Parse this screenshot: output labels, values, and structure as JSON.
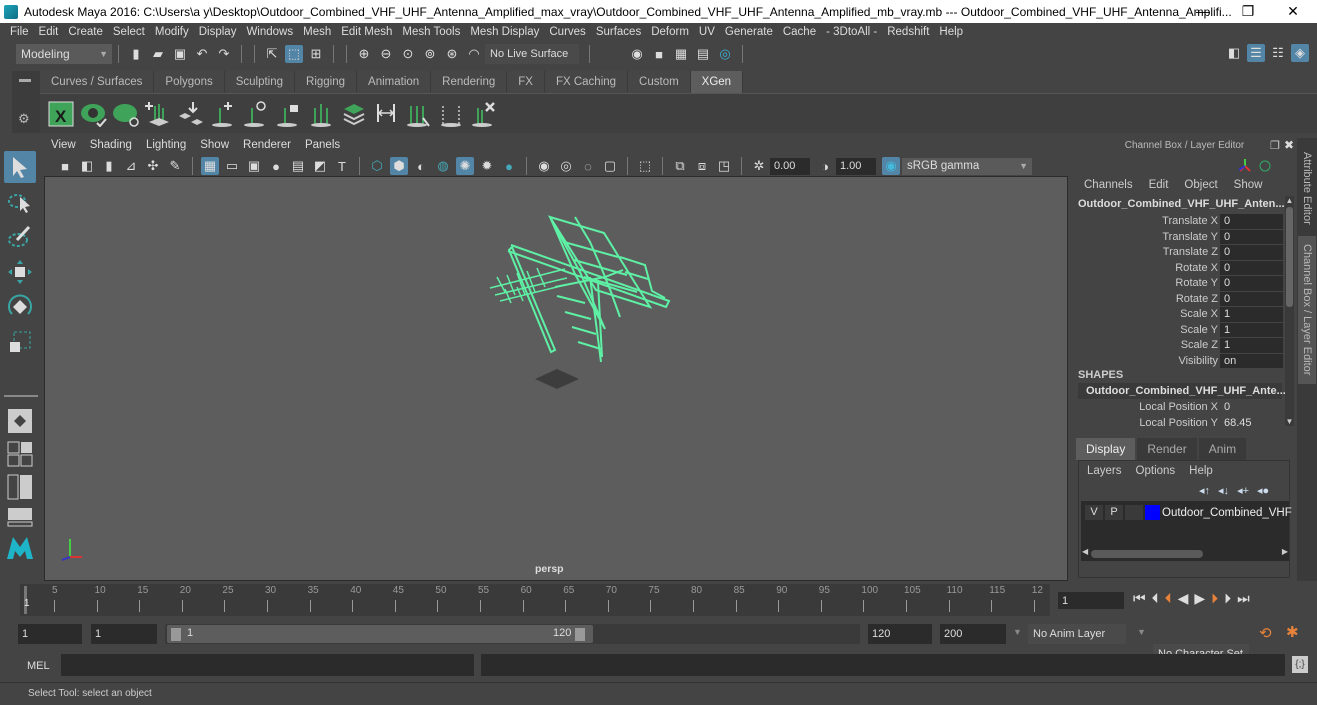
{
  "window": {
    "title": "Autodesk Maya 2016: C:\\Users\\a y\\Desktop\\Outdoor_Combined_VHF_UHF_Antenna_Amplified_max_vray\\Outdoor_Combined_VHF_UHF_Antenna_Amplified_mb_vray.mb  ---  Outdoor_Combined_VHF_UHF_Antenna_Amplifi...",
    "minimize": "—",
    "restore": "❐",
    "close": "✕"
  },
  "menubar": [
    "File",
    "Edit",
    "Create",
    "Select",
    "Modify",
    "Display",
    "Windows",
    "Mesh",
    "Edit Mesh",
    "Mesh Tools",
    "Mesh Display",
    "Curves",
    "Surfaces",
    "Deform",
    "UV",
    "Generate",
    "Cache",
    "- 3DtoAll -",
    "Redshift",
    "Help"
  ],
  "statusline": {
    "menuset": "Modeling",
    "live_surface": "No Live Surface"
  },
  "shelf": {
    "tabs": [
      "Curves / Surfaces",
      "Polygons",
      "Sculpting",
      "Rigging",
      "Animation",
      "Rendering",
      "FX",
      "FX Caching",
      "Custom",
      "XGen"
    ],
    "active_tab": "XGen",
    "icons": [
      "xgen-editor-icon",
      "toggle-preview-icon",
      "clear-preview-icon",
      "add-guides-icon",
      "move-guides-icon",
      "add-guide-icon",
      "guide-visibility-icon",
      "lock-guides-icon",
      "select-guides-icon",
      "guide-sculpt-icon",
      "guide-length-icon",
      "rebuild-guides-icon",
      "guides-to-curves-icon",
      "delete-guides-icon"
    ]
  },
  "viewport": {
    "menu": [
      "View",
      "Shading",
      "Lighting",
      "Show",
      "Renderer",
      "Panels"
    ],
    "exposure": "0.00",
    "gamma": "1.00",
    "color_space": "sRGB gamma",
    "camera_label": "persp",
    "wire_color": "#5ef0a4"
  },
  "channel_box": {
    "title": "Channel Box / Layer Editor",
    "menu": [
      "Channels",
      "Edit",
      "Object",
      "Show"
    ],
    "object_name": "Outdoor_Combined_VHF_UHF_Anten...",
    "channels": [
      {
        "label": "Translate X",
        "value": "0"
      },
      {
        "label": "Translate Y",
        "value": "0"
      },
      {
        "label": "Translate Z",
        "value": "0"
      },
      {
        "label": "Rotate X",
        "value": "0"
      },
      {
        "label": "Rotate Y",
        "value": "0"
      },
      {
        "label": "Rotate Z",
        "value": "0"
      },
      {
        "label": "Scale X",
        "value": "1"
      },
      {
        "label": "Scale Y",
        "value": "1"
      },
      {
        "label": "Scale Z",
        "value": "1"
      },
      {
        "label": "Visibility",
        "value": "on"
      }
    ],
    "shapes_header": "SHAPES",
    "shape_name": "Outdoor_Combined_VHF_UHF_Ante...",
    "shape_channels": [
      {
        "label": "Local Position X",
        "value": "0"
      },
      {
        "label": "Local Position Y",
        "value": "68.45"
      }
    ]
  },
  "side_tabs": [
    "Attribute Editor",
    "Channel Box / Layer Editor"
  ],
  "layer_editor": {
    "tabs": [
      "Display",
      "Render",
      "Anim"
    ],
    "active_tab": "Display",
    "menu": [
      "Layers",
      "Options",
      "Help"
    ],
    "layer": {
      "v": "V",
      "p": "P",
      "color": "#0000ff",
      "name": "Outdoor_Combined_VHF"
    }
  },
  "timeline": {
    "ticks": [
      "5",
      "10",
      "15",
      "20",
      "25",
      "30",
      "35",
      "40",
      "45",
      "50",
      "55",
      "60",
      "65",
      "70",
      "75",
      "80",
      "85",
      "90",
      "95",
      "100",
      "105",
      "110",
      "115",
      "12"
    ],
    "current_frame_marker": "1",
    "current_frame": "1"
  },
  "range": {
    "start": "1",
    "playback_start": "1",
    "slider_start": "1",
    "slider_end": "120",
    "playback_end": "120",
    "end": "200",
    "anim_layer": "No Anim Layer",
    "character_set": "No Character Set"
  },
  "command_line": {
    "label": "MEL"
  },
  "help_line": "Select Tool: select an object"
}
